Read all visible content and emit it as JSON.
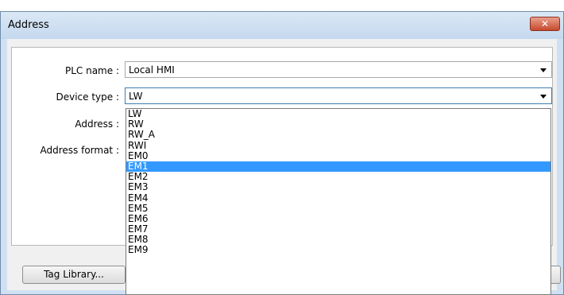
{
  "window": {
    "title": "Address",
    "close_glyph": "✕"
  },
  "form": {
    "plc_name_label": "PLC name :",
    "plc_name_value": "Local HMI",
    "device_type_label": "Device type :",
    "device_type_value": "LW",
    "address_label": "Address :",
    "address_format_label": "Address format :"
  },
  "dropdown": {
    "options": [
      "LW",
      "RW",
      "RW_A",
      "RWI",
      "EM0",
      "EM1",
      "EM2",
      "EM3",
      "EM4",
      "EM5",
      "EM6",
      "EM7",
      "EM8",
      "EM9"
    ],
    "selected": "EM1"
  },
  "buttons": {
    "tag_library": "Tag Library..."
  },
  "colors": {
    "selection": "#3399ff",
    "title_bar": "#cfe0f2",
    "close_button": "#c74a2e"
  }
}
